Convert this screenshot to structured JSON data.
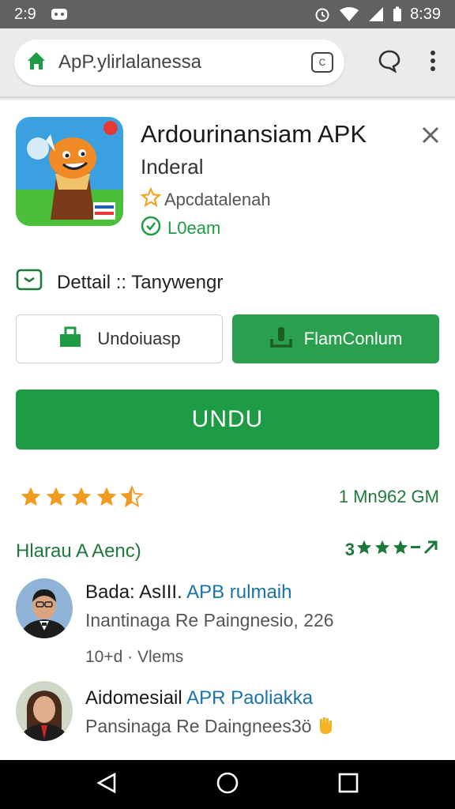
{
  "status_bar": {
    "time": "2:9",
    "right_time": "8:39"
  },
  "browser": {
    "url": "ApP.ylirlalanessa",
    "tab_count": "C"
  },
  "app": {
    "title": "Ardourinansiam APK",
    "developer": "Inderal",
    "rating_label": "Apcdatalenah",
    "status_label": "L0eam"
  },
  "detail": {
    "label": "Dettail :: Tanywengr"
  },
  "buttons": {
    "outline_label": "Undoiuasp",
    "green_label": "FlamConlum",
    "main_label": "UNDU"
  },
  "rating": {
    "stars": 4.5,
    "downloads": "1 Mn962 GM"
  },
  "reviews": {
    "title": "Hlarau A Aenc)",
    "stars_text": "3",
    "items": [
      {
        "name_prefix": "Bada: AsIII.",
        "name_highlight": "APB rulmaih",
        "subtitle": "Inantinaga Re Paingnesio, 226",
        "meta": "10+d · Vlems"
      },
      {
        "name_prefix": "Aidomesiail",
        "name_highlight": "APR Paoliakka",
        "subtitle": "Pansinaga Re Daingnees3ö"
      }
    ]
  },
  "colors": {
    "accent_green": "#1e9c45",
    "star_orange": "#f29c1f",
    "link_blue": "#1a73a8"
  }
}
